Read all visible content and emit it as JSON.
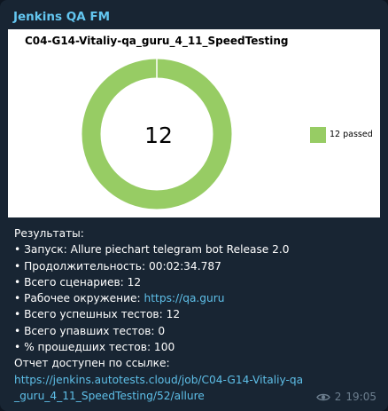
{
  "message": {
    "sender": "Jenkins QA FM",
    "views": "2",
    "time": "19:05"
  },
  "chart": {
    "title": "C04-G14-Vitaliy-qa_guru_4_11_SpeedTesting",
    "center_value": "12",
    "legend_label": "12 passed",
    "colors": {
      "passed": "#97cc64"
    }
  },
  "chart_data": {
    "type": "pie",
    "title": "C04-G14-Vitaliy-qa_guru_4_11_SpeedTesting",
    "labels": [
      "12 passed"
    ],
    "values": [
      12
    ],
    "center_text": "12",
    "legend_position": "right"
  },
  "results": {
    "header": "Результаты:",
    "launch_label": "• Запуск:",
    "launch_value": " Allure piechart telegram bot Release 2.0",
    "duration_label": "• Продолжительность:",
    "duration_value": " 00:02:34.787",
    "scenarios_label": "• Всего сценариев:",
    "scenarios_value": " 12",
    "env_label": "• Рабочее окружение:",
    "env_link": "https://qa.guru",
    "passed_label": "• Всего успешных тестов:",
    "passed_value": " 12",
    "failed_label": "• Всего упавших тестов:",
    "failed_value": " 0",
    "percent_label": "• % прошедших тестов:",
    "percent_value": " 100",
    "report_label": "Отчет доступен по ссылке:",
    "report_link": "https://jenkins.autotests.cloud/job/C04-G14-Vitaliy-qa_guru_4_11_SpeedTesting/52/allure"
  }
}
